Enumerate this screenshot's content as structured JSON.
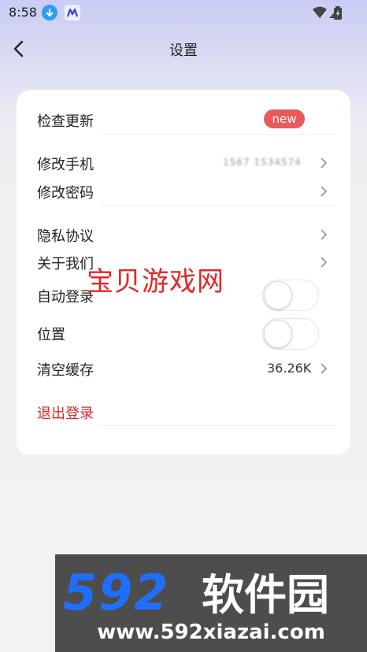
{
  "status_bar": {
    "time": "8:58"
  },
  "header": {
    "title": "设置"
  },
  "settings": {
    "check_update": {
      "label": "检查更新",
      "badge": "new"
    },
    "change_phone": {
      "label": "修改手机",
      "value": "1567 1534574"
    },
    "change_password": {
      "label": "修改密码"
    },
    "privacy": {
      "label": "隐私协议"
    },
    "about": {
      "label": "关于我们"
    },
    "auto_login": {
      "label": "自动登录",
      "enabled": false
    },
    "location": {
      "label": "位置",
      "enabled": false
    },
    "clear_cache": {
      "label": "清空缓存",
      "value": "36.26K"
    },
    "logout": {
      "label": "退出登录"
    }
  },
  "watermark": {
    "text": "宝贝游戏网"
  },
  "ad": {
    "brand": "592软件园",
    "url": "www.592xiazai.com"
  },
  "colors": {
    "accent_red": "#e02828",
    "badge_red": "#e95a5a",
    "logout_red": "#d42a2a",
    "ad_blue": "#1f6fff",
    "ad_bg": "#4d4d4d"
  }
}
